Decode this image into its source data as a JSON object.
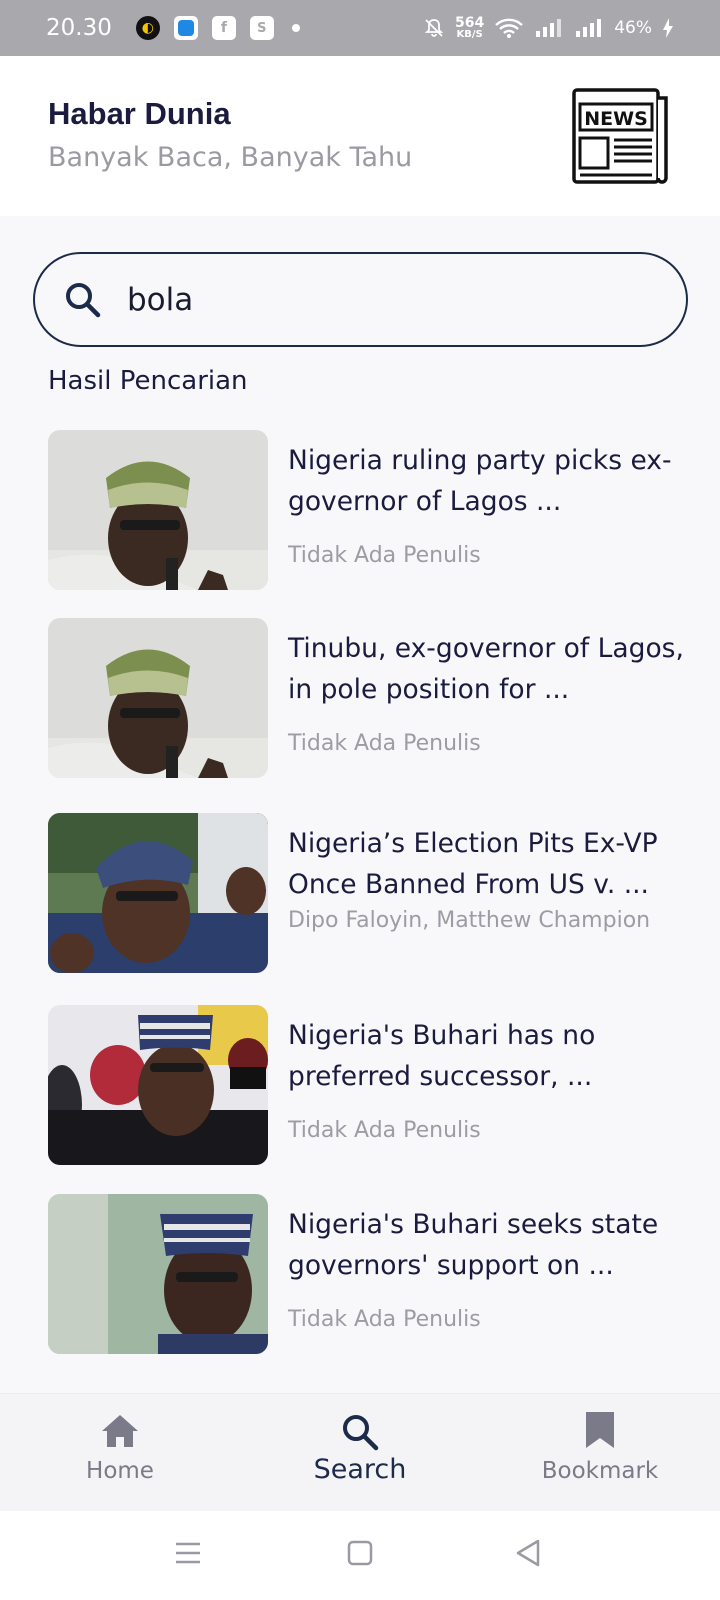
{
  "status_bar": {
    "time": "20.30",
    "net_speed_value": "564",
    "net_speed_unit": "KB/S",
    "battery": "46%"
  },
  "header": {
    "title": "Habar Dunia",
    "subtitle": "Banyak Baca, Banyak Tahu",
    "logo_text": "NEWS"
  },
  "search": {
    "value": "bola",
    "results_label": "Hasil Pencarian"
  },
  "results": [
    {
      "title": "Nigeria ruling party picks ex-governor of Lagos ...",
      "author": "Tidak Ada Penulis"
    },
    {
      "title": "Tinubu, ex-governor of Lagos, in pole position for ...",
      "author": "Tidak Ada Penulis"
    },
    {
      "title": "Nigeria’s Election Pits Ex-VP Once Banned From US v. ...",
      "author": "Dipo Faloyin, Matthew Champion"
    },
    {
      "title": "Nigeria's Buhari has no preferred successor, ...",
      "author": "Tidak Ada Penulis"
    },
    {
      "title": "Nigeria's Buhari seeks state governors' support on ...",
      "author": "Tidak Ada Penulis"
    }
  ],
  "bottom_nav": {
    "items": [
      {
        "label": "Home",
        "icon": "home-icon",
        "active": false
      },
      {
        "label": "Search",
        "icon": "search-icon",
        "active": true
      },
      {
        "label": "Bookmark",
        "icon": "bookmark-icon",
        "active": false
      }
    ]
  },
  "colors": {
    "active_nav": "#1c2b4a",
    "inactive_nav": "#7a7a88",
    "title_text": "#1b1b3f",
    "muted_text": "#9c9ca4"
  }
}
